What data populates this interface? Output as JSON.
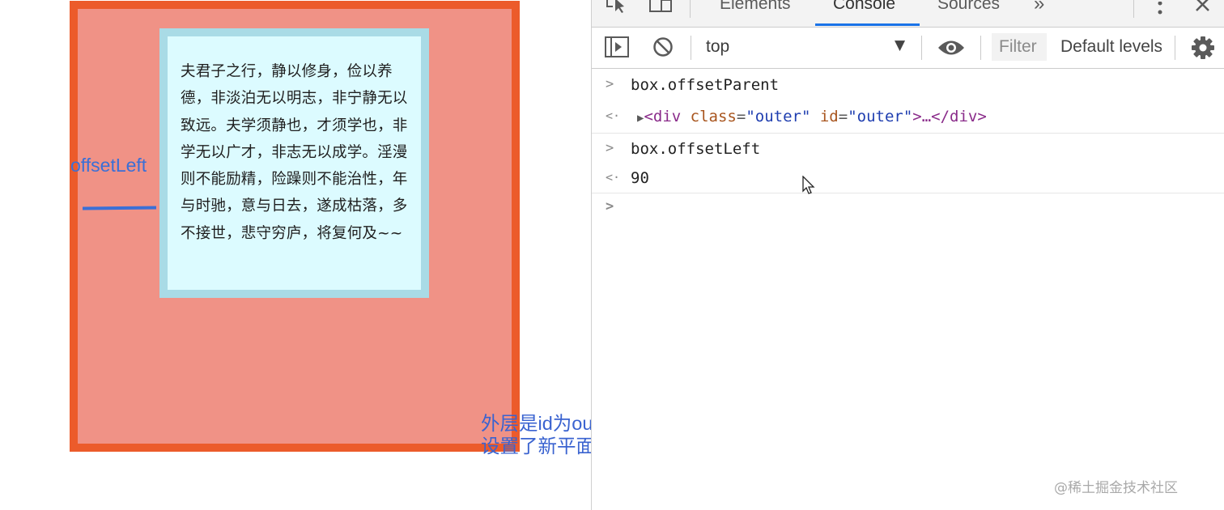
{
  "demo": {
    "inner_text": "夫君子之行，静以修身，俭以养德，非淡泊无以明志，非宁静无以致远。夫学须静也，才须学也，非学无以广才，非志无以成学。淫漫则不能励精，险躁则不能治性，年与时驰，意与日去，遂成枯落，多不接世，悲守穷庐，将复何及~~",
    "annotation_label": "offsetLeft",
    "caption_line1": "外层是id为outer的div，样式设置了定位relative，因为",
    "caption_line2": "设置了新平面，所以父参照物有body变成了id为outer的div",
    "colors": {
      "outer_border": "#ec5b2b",
      "outer_bg": "#f09286",
      "inner_border": "#a9dbe6",
      "inner_bg": "#dcfbff",
      "annotation": "#3b6fd6"
    }
  },
  "devtools": {
    "tabs": [
      {
        "label": "Elements",
        "active": false
      },
      {
        "label": "Console",
        "active": true
      },
      {
        "label": "Sources",
        "active": false
      }
    ],
    "more_tabs_label": "»",
    "toolbar_icons": [
      "inspect-icon",
      "device-toggle-icon",
      "more-vertical-icon",
      "close-icon"
    ],
    "context_select": "top",
    "context_arrow": "▼",
    "filter_placeholder": "Filter",
    "level_select": "Default levels",
    "console_bar_icons": [
      "sidebar-toggle-icon",
      "clear-console-icon",
      "eye-icon",
      "settings-gear-icon"
    ],
    "accent_color": "#1a73e8",
    "log": [
      {
        "kind": "input",
        "mark": ">",
        "text": "box.offsetParent"
      },
      {
        "kind": "output-element",
        "mark": "<·",
        "expand": "▶",
        "lt": "<",
        "tag": "div",
        "attr1": "class",
        "val1": "\"outer\"",
        "attr2": "id",
        "val2": "\"outer\"",
        "ellipsis": ">…</",
        "close": ">"
      },
      {
        "kind": "input",
        "mark": ">",
        "text": "box.offsetLeft"
      },
      {
        "kind": "output-number",
        "mark": "<·",
        "text": "90"
      },
      {
        "kind": "prompt",
        "mark": ">"
      }
    ]
  },
  "watermark": "@稀土掘金技术社区"
}
